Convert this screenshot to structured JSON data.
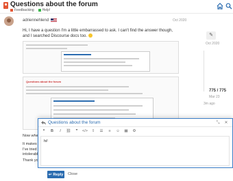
{
  "header": {
    "topic_title": "Questions about the forum",
    "categories": [
      {
        "label": "Feedbacking",
        "color": "#e45735"
      },
      {
        "label": "Help!",
        "color": "#3ab54a"
      }
    ]
  },
  "post": {
    "username": "adriennehlend",
    "date": "Oct 2020",
    "body": "Hi, I have a question I'm a little embarrassed to ask. I can't find the answer though, and I searched Discourse docs too.",
    "embedded_title": "Questions about the forum",
    "continuation": [
      "Now when I wa",
      "It makes it very",
      "I've tried clickin",
      "intolerable!",
      "Thank you so m"
    ]
  },
  "timeline": {
    "start_date": "Oct 2020",
    "count": "775 / 775",
    "end_date": "Mar 23",
    "ago": "3m ago"
  },
  "composer": {
    "title": "Questions about the forum",
    "editor_text": "hi!",
    "reply_label": "Reply",
    "close_label": "Close"
  }
}
